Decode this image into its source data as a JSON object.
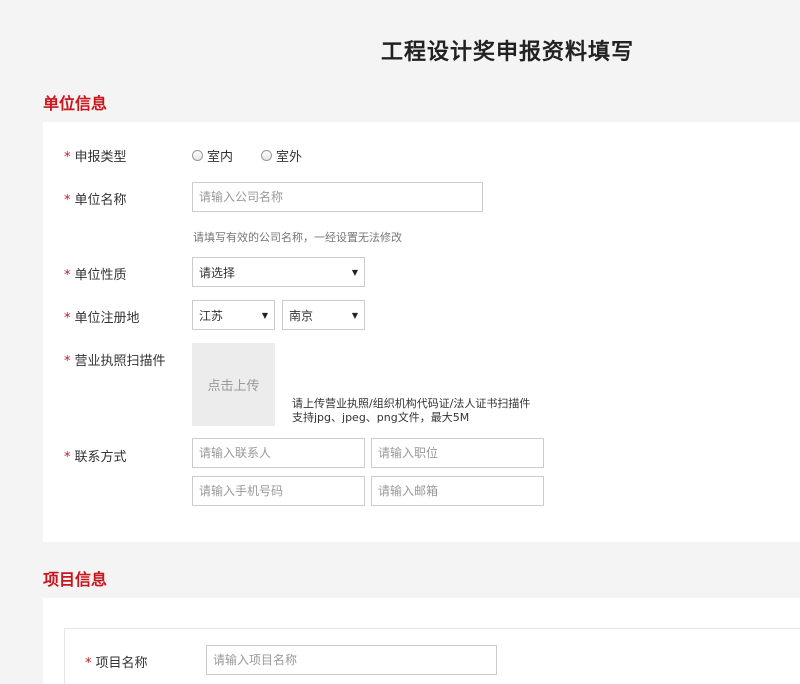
{
  "page": {
    "title": "工程设计奖申报资料填写"
  },
  "company_section": {
    "title": "单位信息",
    "declaration_type": {
      "label": "申报类型",
      "options": [
        "室内",
        "室外"
      ]
    },
    "company_name": {
      "label": "单位名称",
      "placeholder": "请输入公司名称",
      "hint": "请填写有效的公司名称，一经设置无法修改"
    },
    "company_nature": {
      "label": "单位性质",
      "selected": "请选择"
    },
    "registration_place": {
      "label": "单位注册地",
      "province": "江苏",
      "city": "南京"
    },
    "license_scan": {
      "label": "营业执照扫描件",
      "button": "点击上传",
      "tip_line1": "请上传营业执照/组织机构代码证/法人证书扫描件",
      "tip_line2": "支持jpg、jpeg、png文件，最大5M"
    },
    "contact": {
      "label": "联系方式",
      "contact_person_placeholder": "请输入联系人",
      "position_placeholder": "请输入职位",
      "phone_placeholder": "请输入手机号码",
      "email_placeholder": "请输入邮箱"
    }
  },
  "project_section": {
    "title": "项目信息",
    "project_name": {
      "label": "项目名称",
      "placeholder": "请输入项目名称"
    }
  },
  "colors": {
    "accent": "#c8161d",
    "background": "#f4f4f4",
    "panel": "#ffffff",
    "border": "#cccccc"
  }
}
